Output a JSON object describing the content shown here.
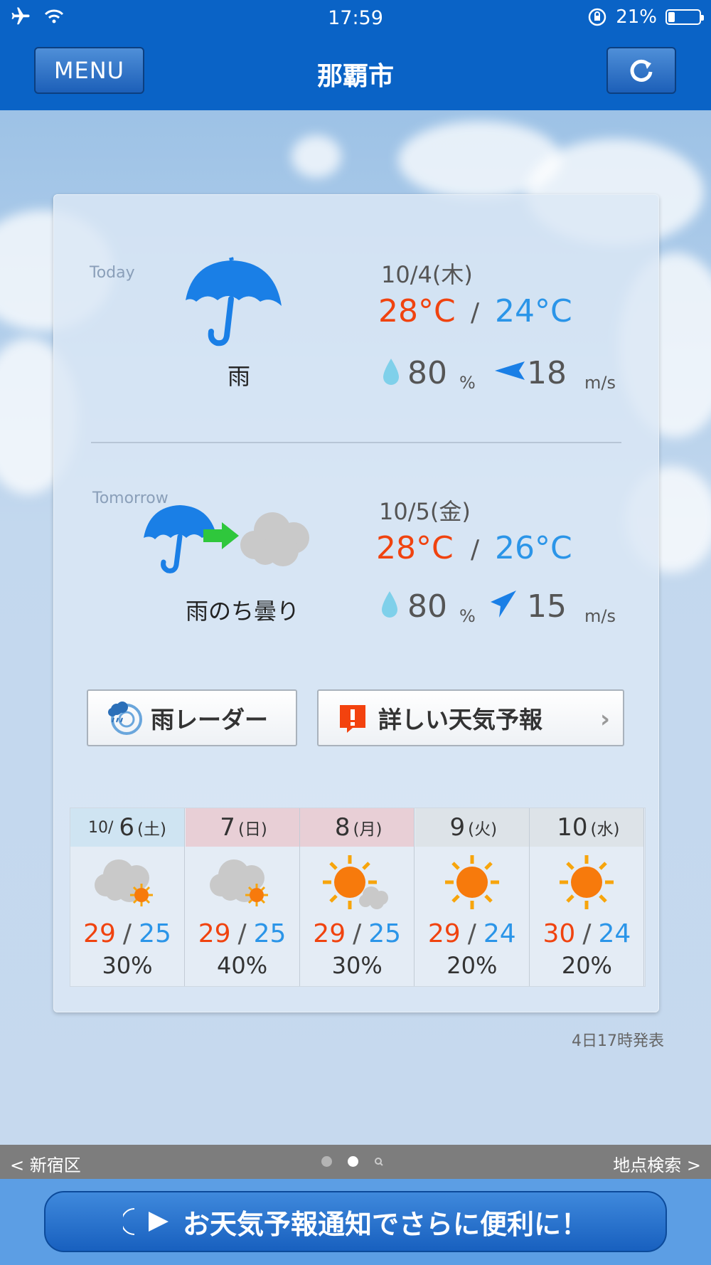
{
  "status_bar": {
    "time": "17:59",
    "battery": "21%",
    "battery_level": 0.21
  },
  "header": {
    "menu_label": "MENU",
    "city": "那覇市"
  },
  "today": {
    "label": "Today",
    "date": "10/4(木)",
    "weather": "雨",
    "high": "28°C",
    "low": "24°C",
    "slash": "/",
    "rain": "80",
    "rain_unit": "%",
    "wind": "18",
    "wind_unit": "m/s"
  },
  "tomorrow": {
    "label": "Tomorrow",
    "date": "10/5(金)",
    "weather": "雨のち曇り",
    "high": "28°C",
    "low": "26°C",
    "slash": "/",
    "rain": "80",
    "rain_unit": "%",
    "wind": "15",
    "wind_unit": "m/s"
  },
  "buttons": {
    "radar": "雨レーダー",
    "detail": "詳しい天気予報"
  },
  "week": [
    {
      "month": "10/",
      "day": "6",
      "weekday": "(土)",
      "high": "29",
      "low": "25",
      "rain": "30%",
      "icon": "cloudy-sun-icon",
      "head_color": "#cfe4f2"
    },
    {
      "month": "",
      "day": "7",
      "weekday": "(日)",
      "high": "29",
      "low": "25",
      "rain": "40%",
      "icon": "cloudy-sun-icon",
      "head_color": "#e8cfd6"
    },
    {
      "month": "",
      "day": "8",
      "weekday": "(月)",
      "high": "29",
      "low": "25",
      "rain": "30%",
      "icon": "sun-cloud-icon",
      "head_color": "#e8cfd6"
    },
    {
      "month": "",
      "day": "9",
      "weekday": "(火)",
      "high": "29",
      "low": "24",
      "rain": "20%",
      "icon": "sun-icon",
      "head_color": "#dde3e8"
    },
    {
      "month": "",
      "day": "10",
      "weekday": "(水)",
      "high": "30",
      "low": "24",
      "rain": "20%",
      "icon": "sun-icon",
      "head_color": "#dde3e8"
    }
  ],
  "issued": "4日17時発表",
  "nav": {
    "prev": "< 新宿区",
    "next": "地点検索 >"
  },
  "notify": "お天気予報通知でさらに便利に！"
}
